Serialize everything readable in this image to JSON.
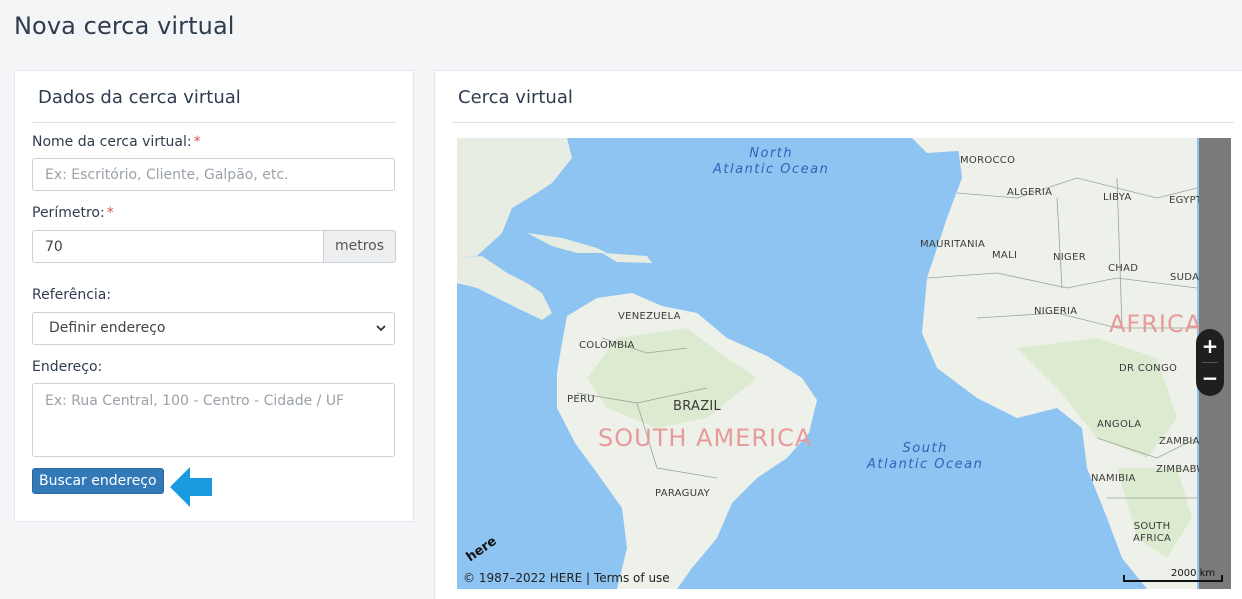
{
  "page": {
    "title": "Nova cerca virtual"
  },
  "form_panel": {
    "title": "Dados da cerca virtual",
    "name_label": "Nome da cerca virtual:",
    "name_placeholder": "Ex: Escritório, Cliente, Galpão, etc.",
    "perimeter_label": "Perímetro:",
    "perimeter_value": "70",
    "perimeter_unit": "metros",
    "reference_label": "Referência:",
    "reference_selected": "Definir endereço",
    "address_label": "Endereço:",
    "address_placeholder": "Ex: Rua Central, 100 - Centro - Cidade / UF",
    "search_button": "Buscar endereço",
    "required_mark": "*"
  },
  "map_panel": {
    "title": "Cerca virtual",
    "copyright": "© 1987–2022 HERE | Terms of use",
    "scale": "2000 km",
    "zoom_in": "+",
    "zoom_out": "−",
    "logo": "here",
    "labels": {
      "north_atlantic": "North\nAtlantic Ocean",
      "south_atlantic": "South\nAtlantic Ocean",
      "south_america": "SOUTH AMERICA",
      "africa": "AFRICA",
      "morocco": "MOROCCO",
      "algeria": "ALGERIA",
      "libya": "LIBYA",
      "egypt": "EGYPT",
      "mauritania": "MAURITANIA",
      "mali": "MALI",
      "niger": "NIGER",
      "chad": "CHAD",
      "sudan": "SUDA",
      "nigeria": "NIGERIA",
      "dr_congo": "DR CONGO",
      "angola": "ANGOLA",
      "zambia": "ZAMBIA",
      "zimbabwe": "ZIMBABWE",
      "namibia": "NAMIBIA",
      "south_africa": "SOUTH\nAFRICA",
      "venezuela": "VENEZUELA",
      "colombia": "COLOMBIA",
      "peru": "PERU",
      "brazil": "BRAZIL",
      "paraguay": "PARAGUAY"
    }
  },
  "icons": {
    "arrow": "arrow-left-icon",
    "chevron": "chevron-down-icon"
  },
  "colors": {
    "primary": "#3379b7",
    "arrow": "#1a9ae0",
    "required": "#d9534f",
    "ocean": "#8ec4f2",
    "land": "#eef1ea",
    "continent_label": "#e89a9a"
  }
}
